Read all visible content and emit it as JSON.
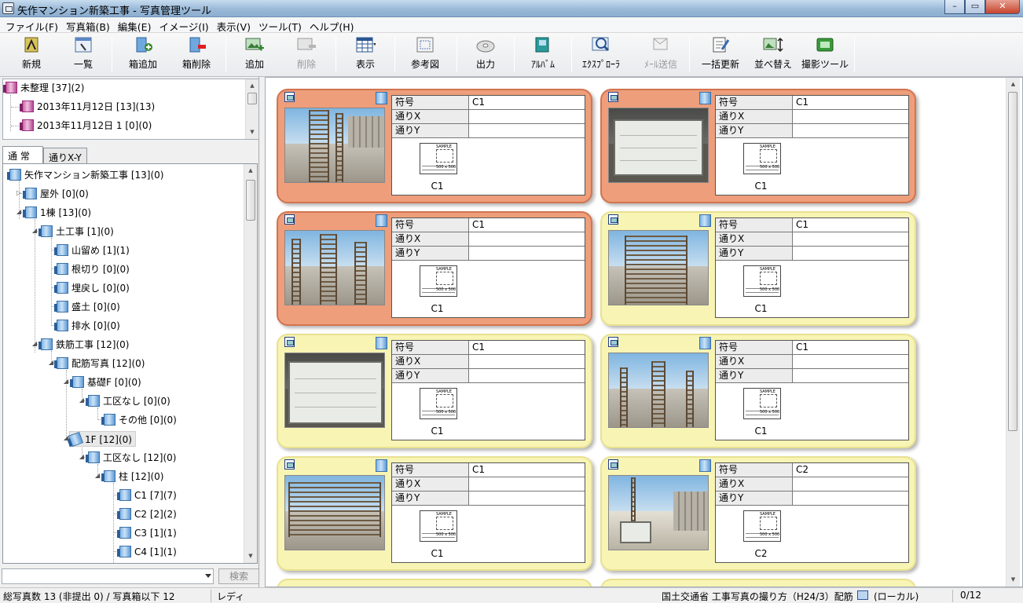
{
  "window": {
    "title": "矢作マンション新築工事 - 写真管理ツール",
    "minimize": "–",
    "maximize": "▭",
    "close": "✕"
  },
  "menu": [
    "ファイル(F)",
    "写真箱(B)",
    "編集(E)",
    "イメージ(I)",
    "表示(V)",
    "ツール(T)",
    "ヘルプ(H)"
  ],
  "toolbar": {
    "new": "新規",
    "list": "一覧",
    "add_box": "箱追加",
    "delete_box": "箱削除",
    "add": "追加",
    "delete": "削除",
    "view": "表示",
    "reference": "参考図",
    "output": "出力",
    "album": "ｱﾙﾊﾞﾑ",
    "explorer": "ｴｸｽﾌﾟﾛｰﾗ",
    "mail": "ﾒｰﾙ送信",
    "bulk_update": "一括更新",
    "sort": "並べ替え",
    "shoot_tool": "撮影ツール"
  },
  "unsorted": {
    "root": "未整理 [37](2)",
    "items": [
      "2013年11月12日 [13](13)",
      "2013年11月12日 1 [0](0)"
    ]
  },
  "tabs": {
    "normal": "通 常",
    "grid": "通りX-Y"
  },
  "tree": [
    {
      "label": "矢作マンション新築工事 [13](0)"
    },
    {
      "label": "屋外 [0](0)"
    },
    {
      "label": "1棟 [13](0)"
    },
    {
      "label": "土工事 [1](0)"
    },
    {
      "label": "山留め [1](1)"
    },
    {
      "label": "根切り [0](0)"
    },
    {
      "label": "埋戻し [0](0)"
    },
    {
      "label": "盛土 [0](0)"
    },
    {
      "label": "排水 [0](0)"
    },
    {
      "label": "鉄筋工事 [12](0)"
    },
    {
      "label": "配筋写真 [12](0)"
    },
    {
      "label": "基礎F [0](0)"
    },
    {
      "label": "工区なし [0](0)"
    },
    {
      "label": "その他 [0](0)"
    },
    {
      "label": "1F [12](0)"
    },
    {
      "label": "工区なし [12](0)"
    },
    {
      "label": "柱 [12](0)"
    },
    {
      "label": "C1 [7](7)"
    },
    {
      "label": "C2 [2](2)"
    },
    {
      "label": "C3 [1](1)"
    },
    {
      "label": "C4 [1](1)"
    }
  ],
  "search": {
    "value": "",
    "button": "検索"
  },
  "field_labels": {
    "code": "符号",
    "grid_x": "通りX",
    "grid_y": "通りY"
  },
  "sketch": {
    "sample": "SAMPLE",
    "size": "500 x 500"
  },
  "cards": [
    {
      "code": "C1",
      "caption": "C1",
      "selected": true
    },
    {
      "code": "C1",
      "caption": "C1",
      "selected": true
    },
    {
      "code": "C1",
      "caption": "C1",
      "selected": true
    },
    {
      "code": "C1",
      "caption": "C1",
      "selected": false
    },
    {
      "code": "C1",
      "caption": "C1",
      "selected": false
    },
    {
      "code": "C1",
      "caption": "C1",
      "selected": false
    },
    {
      "code": "C1",
      "caption": "C1",
      "selected": false
    },
    {
      "code": "C2",
      "caption": "C2",
      "selected": false
    }
  ],
  "status": {
    "count": "総写真数 13 (非提出 0) / 写真箱以下 12",
    "state": "レディ",
    "standard": "国土交通省 工事写真の撮り方（H24/3）配筋",
    "location": "(ローカル)",
    "pages": "0/12"
  },
  "colors": {
    "selected_card": "#ee9e7a",
    "normal_card": "#f8f4b4",
    "box_blue": "#5b99d6",
    "box_pink": "#b44795"
  }
}
